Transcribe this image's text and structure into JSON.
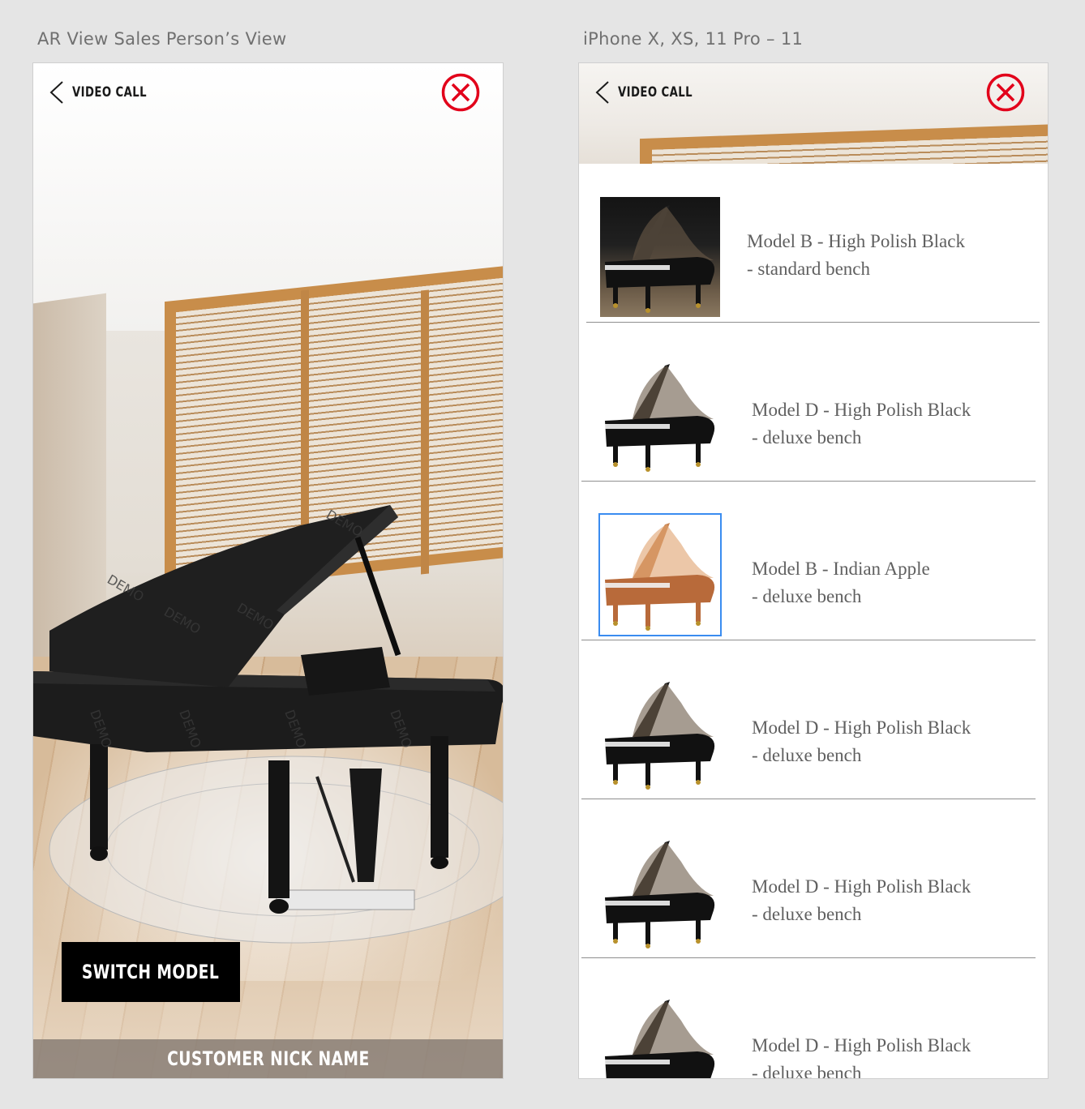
{
  "artboards": {
    "left_title": "AR View Sales Person’s View",
    "right_title": "iPhone X, XS, 11 Pro – 11"
  },
  "header": {
    "back_label": "VIDEO CALL",
    "close_color": "#e2001a"
  },
  "ar_view": {
    "switch_button": "SWITCH MODEL",
    "customer_name": "CUSTOMER NICK NAME"
  },
  "models": [
    {
      "line1": "Model B - High Polish Black",
      "line2": "- standard bench",
      "finish": "black",
      "selected": false
    },
    {
      "line1": "Model D - High Polish Black",
      "line2": "- deluxe bench",
      "finish": "black",
      "selected": false
    },
    {
      "line1": "Model B - Indian Apple",
      "line2": "- deluxe bench",
      "finish": "wood",
      "selected": true
    },
    {
      "line1": "Model D - High Polish Black",
      "line2": "- deluxe bench",
      "finish": "black",
      "selected": false
    },
    {
      "line1": "Model D - High Polish Black",
      "line2": "- deluxe bench",
      "finish": "black",
      "selected": false
    },
    {
      "line1": "Model D - High Polish Black",
      "line2": "- deluxe bench",
      "finish": "black",
      "selected": false
    }
  ],
  "colors": {
    "selected_outline": "#3a8cf0",
    "divider": "#8f8f8f",
    "wood": "#b86a3a"
  }
}
